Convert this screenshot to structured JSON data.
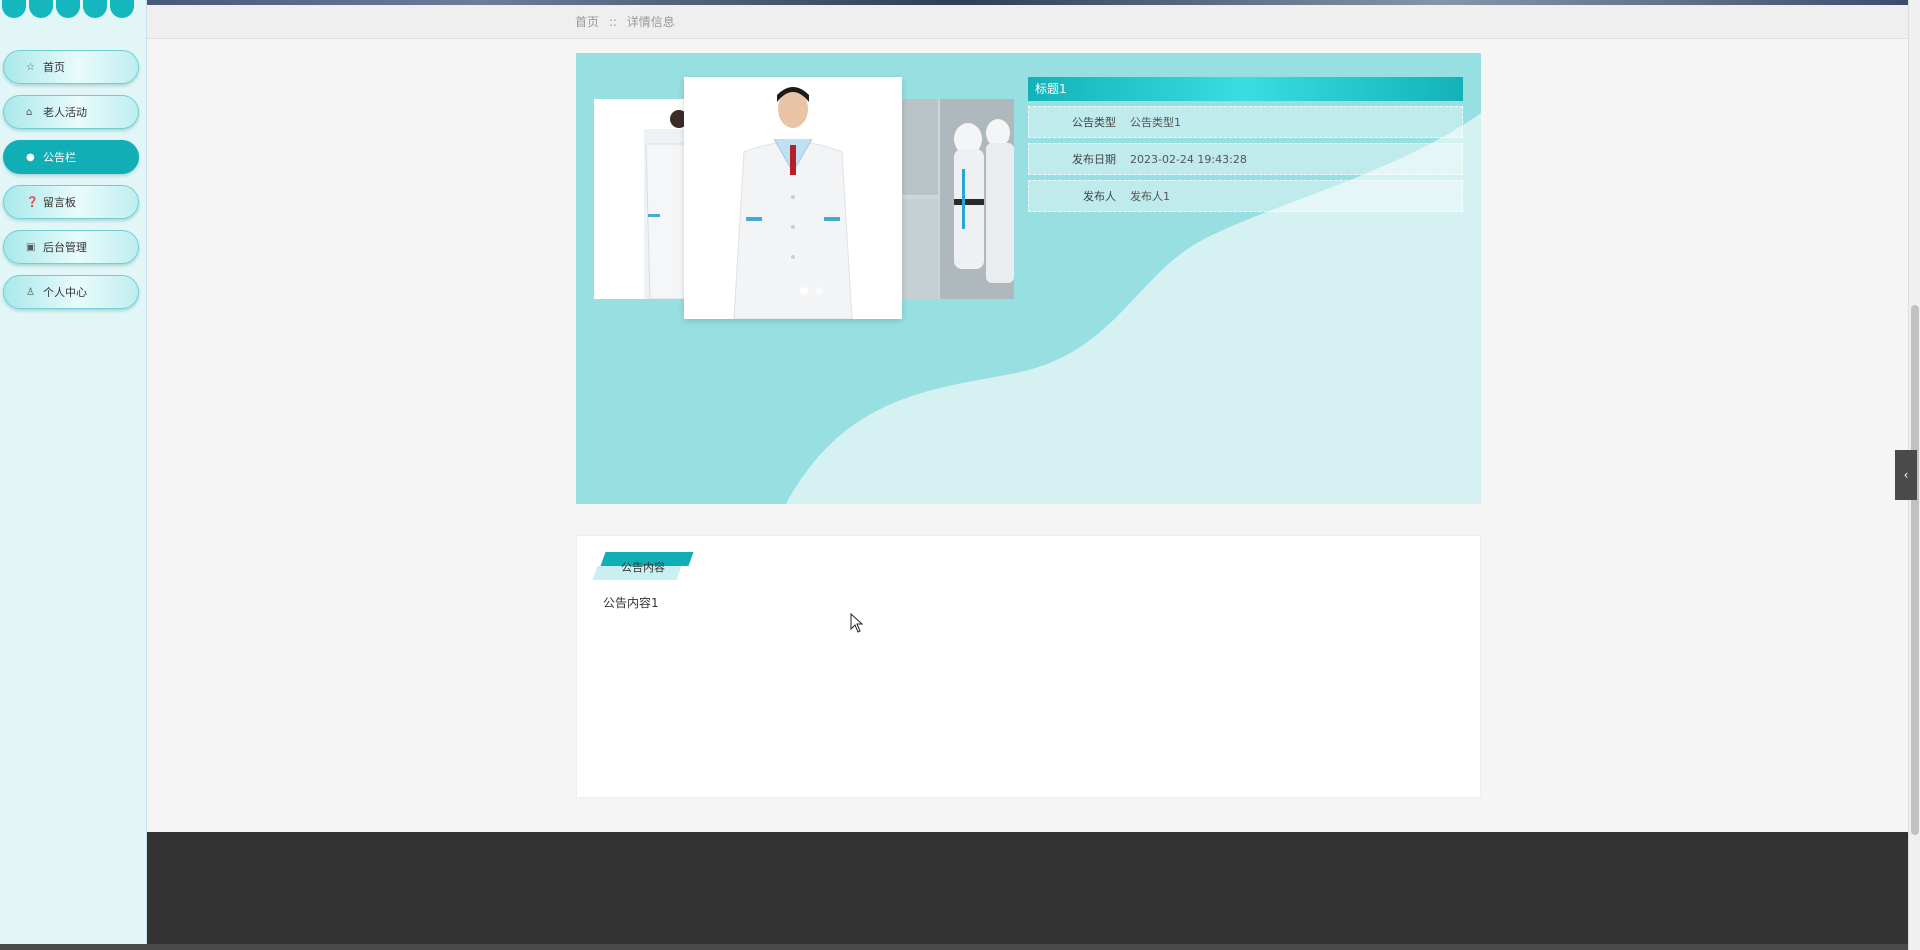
{
  "sidebar": {
    "items": [
      {
        "label": "首页",
        "icon": "star-icon",
        "active": false
      },
      {
        "label": "老人活动",
        "icon": "bag-icon",
        "active": false
      },
      {
        "label": "公告栏",
        "icon": "circle-icon",
        "active": true
      },
      {
        "label": "留言板",
        "icon": "question-icon",
        "active": false
      },
      {
        "label": "后台管理",
        "icon": "box-icon",
        "active": false
      },
      {
        "label": "个人中心",
        "icon": "user-icon",
        "active": false
      }
    ]
  },
  "breadcrumb": {
    "home": "首页",
    "separator": "::",
    "current": "详情信息"
  },
  "detail": {
    "title": "标题1",
    "rows": [
      {
        "label": "公告类型",
        "value": "公告类型1"
      },
      {
        "label": "发布日期",
        "value": "2023-02-24 19:43:28"
      },
      {
        "label": "发布人",
        "value": "发布人1"
      }
    ]
  },
  "content": {
    "section_label": "公告内容",
    "body": "公告内容1"
  },
  "colors": {
    "accent": "#12aeb6",
    "hero_bg": "#98dfe1",
    "footer": "#333333",
    "sidebar_bg": "#e3f6f7"
  }
}
